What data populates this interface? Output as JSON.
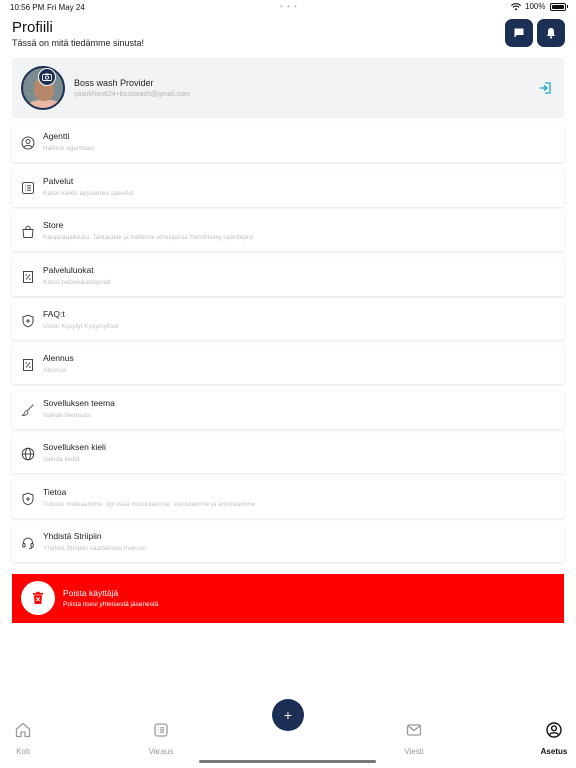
{
  "status_bar": {
    "time": "10:56 PM",
    "date": "Fri May 24",
    "battery": "100%"
  },
  "header": {
    "title": "Profiili",
    "subtitle": "Tässä on mitä tiedämme sinusta!"
  },
  "profile": {
    "name": "Boss wash Provider",
    "email": "yasirkhan624+bosswash@gmail.com"
  },
  "menu": [
    {
      "title": "Agentti",
      "subtitle": "Hallitse agenttiasi",
      "icon": "user-circle-icon"
    },
    {
      "title": "Palvelut",
      "subtitle": "Katso kaikki tarjoamasi palvelut",
      "icon": "list-icon"
    },
    {
      "title": "Store",
      "subtitle": "Kauppapaikkasi: Tarkastele ja hallinnoi ensisijaisia franchising-sijaintejasi",
      "icon": "shopping-bag-icon"
    },
    {
      "title": "Palveluluokat",
      "subtitle": "Katso palvelukategoriat",
      "icon": "receipt-percent-icon"
    },
    {
      "title": "FAQ:t",
      "subtitle": "Usein Kysytyt Kysymykset",
      "icon": "shield-plus-icon"
    },
    {
      "title": "Alennus",
      "subtitle": "Alennus",
      "icon": "discount-icon"
    },
    {
      "title": "Sovelluksen teema",
      "subtitle": "Vaihda teemaasi",
      "icon": "brush-icon"
    },
    {
      "title": "Sovelluksen kieli",
      "subtitle": "Vaihda kieltä",
      "icon": "globe-icon"
    },
    {
      "title": "Tietoa",
      "subtitle": "Tutustu matkaamme: opi lisää missiotamme, visiostamme ja arvoistamme",
      "icon": "shield-info-icon"
    },
    {
      "title": "Yhdistä Striipiin",
      "subtitle": "Yhdistä Striipiin saadaksesi maksun",
      "icon": "headset-icon"
    }
  ],
  "delete_account": {
    "title": "Poista käyttäjä",
    "subtitle": "Poista itsesi yhteisestä jäsenestä"
  },
  "tabs": [
    {
      "label": "Koti",
      "icon": "home-icon"
    },
    {
      "label": "Varaus",
      "icon": "list-icon"
    },
    {
      "label": "Viesti",
      "icon": "mail-icon"
    },
    {
      "label": "Asetus",
      "icon": "user-circle-icon"
    }
  ],
  "fab": {
    "label": "+"
  },
  "colors": {
    "primary": "#1c2f55",
    "danger": "#ff0000",
    "accent": "#1fa0c8"
  }
}
